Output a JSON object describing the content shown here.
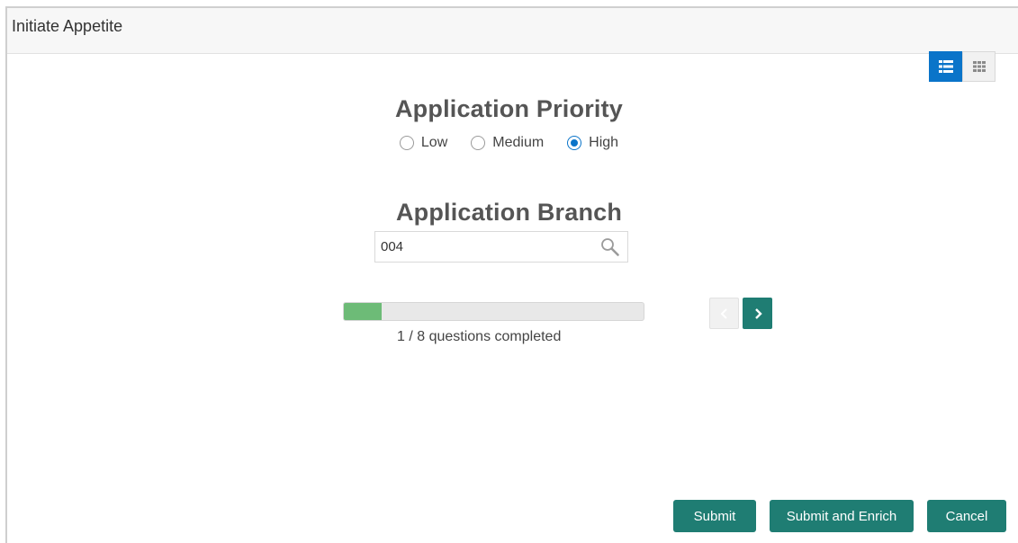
{
  "header": {
    "title": "Initiate Appetite"
  },
  "view_toggle": [
    {
      "icon": "list-view-icon",
      "active": true
    },
    {
      "icon": "grid-view-icon",
      "active": false
    }
  ],
  "priority": {
    "title": "Application Priority",
    "options": [
      {
        "label": "Low",
        "checked": false
      },
      {
        "label": "Medium",
        "checked": false
      },
      {
        "label": "High",
        "checked": true
      }
    ]
  },
  "branch": {
    "title": "Application Branch",
    "value": "004",
    "icon": "search-icon"
  },
  "progress": {
    "completed": 1,
    "total": 8,
    "text": "1 / 8 questions completed"
  },
  "navigation": {
    "prev_icon": "chevron-left-icon",
    "next_icon": "chevron-right-icon"
  },
  "actions": {
    "submit": "Submit",
    "submit_enrich": "Submit and Enrich",
    "cancel": "Cancel"
  },
  "colors": {
    "accent": "#1f7d73",
    "toggle_active": "#0a74c9",
    "progress": "#6dbb77"
  }
}
